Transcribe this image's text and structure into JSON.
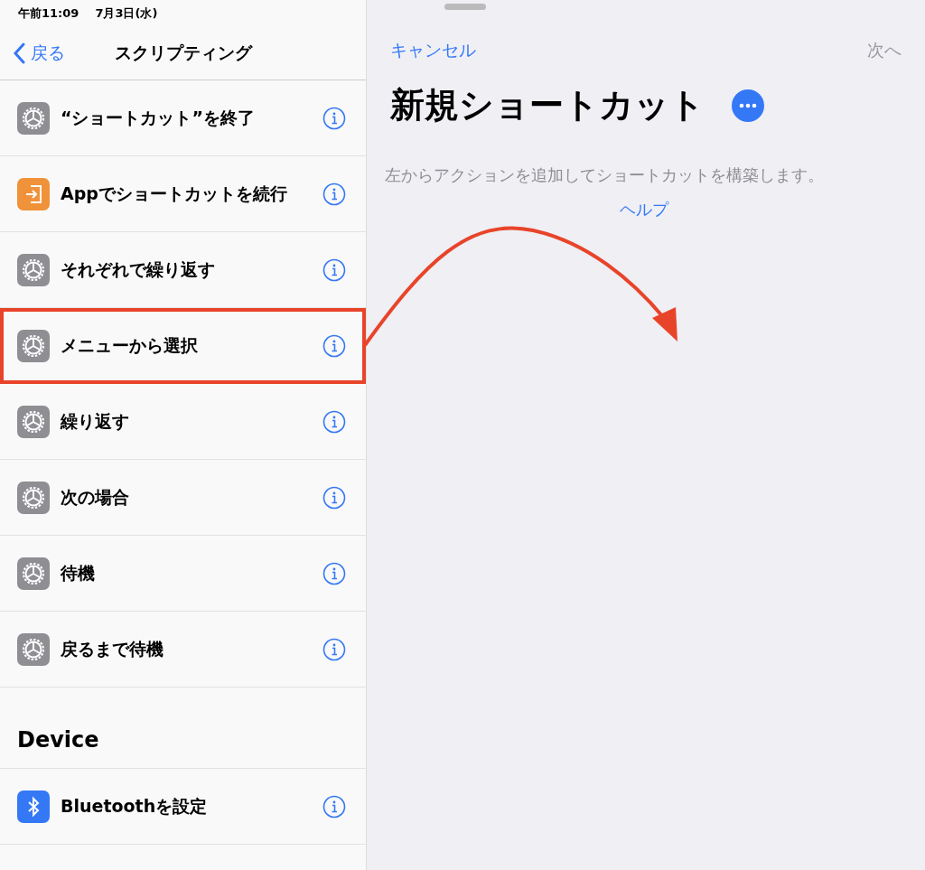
{
  "status_bar": {
    "time": "午前11:09",
    "date": "7月3日(水)"
  },
  "left_panel": {
    "back": "戻る",
    "title": "スクリプティング",
    "items": [
      {
        "label": "“ショートカット”を終了",
        "kind": "gear",
        "highlighted": false
      },
      {
        "label": "Appでショートカットを続行",
        "kind": "app",
        "highlighted": false
      },
      {
        "label": "それぞれで繰り返す",
        "kind": "gear",
        "highlighted": false
      },
      {
        "label": "メニューから選択",
        "kind": "gear",
        "highlighted": true
      },
      {
        "label": "繰り返す",
        "kind": "gear",
        "highlighted": false
      },
      {
        "label": "次の場合",
        "kind": "gear",
        "highlighted": false
      },
      {
        "label": "待機",
        "kind": "gear",
        "highlighted": false
      },
      {
        "label": "戻るまで待機",
        "kind": "gear",
        "highlighted": false
      }
    ],
    "section": {
      "title": "Device",
      "items": [
        {
          "label": "Bluetoothを設定",
          "kind": "bluetooth",
          "highlighted": false
        }
      ]
    }
  },
  "right_panel": {
    "cancel": "キャンセル",
    "next": {
      "label": "次へ",
      "disabled": true
    },
    "title": "新規ショートカット",
    "hint": "左からアクションを追加してショートカットを構築します。",
    "help": "ヘルプ"
  }
}
